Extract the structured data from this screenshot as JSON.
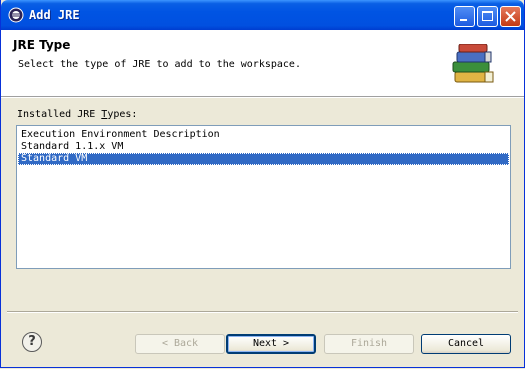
{
  "window": {
    "title": "Add JRE"
  },
  "header": {
    "title": "JRE Type",
    "description": "Select the type of JRE to add to the workspace."
  },
  "list": {
    "label_before": "Installed JRE ",
    "label_mnemonic": "T",
    "label_after": "ypes:",
    "items": [
      {
        "label": "Execution Environment Description",
        "selected": false
      },
      {
        "label": "Standard 1.1.x VM",
        "selected": false
      },
      {
        "label": "Standard VM",
        "selected": true
      }
    ]
  },
  "buttons": {
    "help": "?",
    "back": "< Back",
    "next": "Next >",
    "finish": "Finish",
    "cancel": "Cancel"
  },
  "colors": {
    "selection": "#316ac5",
    "titlebar": "#0054e3",
    "dialog_bg": "#ece9d8"
  },
  "icons": [
    "eclipse-icon",
    "minimize-icon",
    "maximize-icon",
    "close-icon",
    "books-icon",
    "help-icon"
  ]
}
